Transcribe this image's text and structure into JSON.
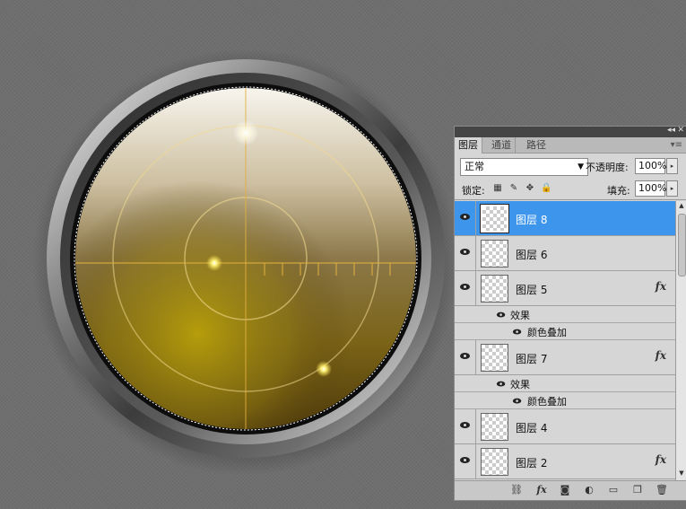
{
  "canvas": {
    "bezel_color": "#9a9a9a",
    "scope_colors": [
      "#f4f2ea",
      "#8b7a45",
      "#a58f10",
      "#5a440e"
    ],
    "crosshair_color": "#e0b040",
    "glow_color": "#ffe34d"
  },
  "panel": {
    "collapse_icon": "double-chevron-left-icon",
    "close_icon": "close-icon",
    "tabs": [
      {
        "label": "图层"
      },
      {
        "label": "通道"
      },
      {
        "label": "路径"
      }
    ],
    "menu_icon": "panel-menu-icon",
    "blend_mode": "正常",
    "opacity_label": "不透明度:",
    "opacity_value": "100%",
    "lock_label": "锁定:",
    "fill_label": "填充:",
    "fill_value": "100%",
    "layers": [
      {
        "name": "图层 8",
        "selected": true,
        "fx": ""
      },
      {
        "name": "图层 6",
        "selected": false,
        "fx": ""
      },
      {
        "name": "图层 5",
        "selected": false,
        "fx": "fx",
        "effects_label": "效果",
        "effect": "颜色叠加"
      },
      {
        "name": "图层 7",
        "selected": false,
        "fx": "fx",
        "effects_label": "效果",
        "effect": "颜色叠加"
      },
      {
        "name": "图层 4",
        "selected": false,
        "fx": ""
      },
      {
        "name": "图层 2",
        "selected": false,
        "fx": "fx"
      }
    ],
    "accent_color": "#3d95ec",
    "bottom_icons": [
      "link-icon",
      "fx-icon",
      "mask-icon",
      "adjustment-icon",
      "folder-icon",
      "new-layer-icon",
      "trash-icon"
    ]
  }
}
